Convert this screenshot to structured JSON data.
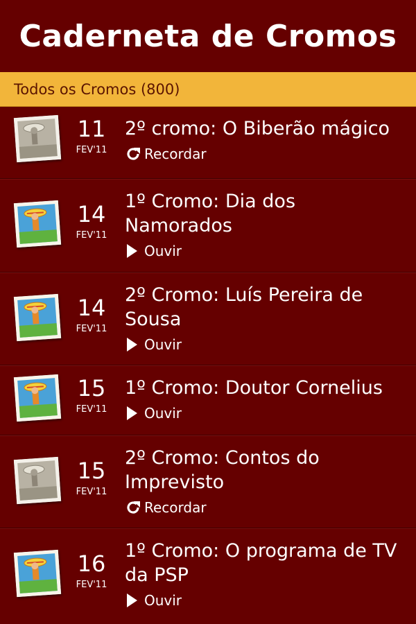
{
  "header": {
    "title": "Caderneta de Cromos"
  },
  "section": {
    "label": "Todos os Cromos (800)"
  },
  "items": [
    {
      "day": "11",
      "month": "FEV'11",
      "title": "2º cromo: O Biberão mágico",
      "action": "Recordar",
      "action_icon": "refresh-icon",
      "thumb": "grey"
    },
    {
      "day": "14",
      "month": "FEV'11",
      "title": "1º Cromo: Dia dos Namorados",
      "action": "Ouvir",
      "action_icon": "play-icon",
      "thumb": "color"
    },
    {
      "day": "14",
      "month": "FEV'11",
      "title": "2º Cromo: Luís Pereira de Sousa",
      "action": "Ouvir",
      "action_icon": "play-icon",
      "thumb": "color"
    },
    {
      "day": "15",
      "month": "FEV'11",
      "title": "1º Cromo: Doutor Cornelius",
      "action": "Ouvir",
      "action_icon": "play-icon",
      "thumb": "color"
    },
    {
      "day": "15",
      "month": "FEV'11",
      "title": "2º Cromo: Contos do Imprevisto",
      "action": "Recordar",
      "action_icon": "refresh-icon",
      "thumb": "grey"
    },
    {
      "day": "16",
      "month": "FEV'11",
      "title": "1º Cromo: O programa de TV da PSP",
      "action": "Ouvir",
      "action_icon": "play-icon",
      "thumb": "color"
    }
  ],
  "colors": {
    "background": "#650000",
    "section_bar": "#f2b53a",
    "section_text": "#5a1400",
    "text": "#ffffff"
  }
}
